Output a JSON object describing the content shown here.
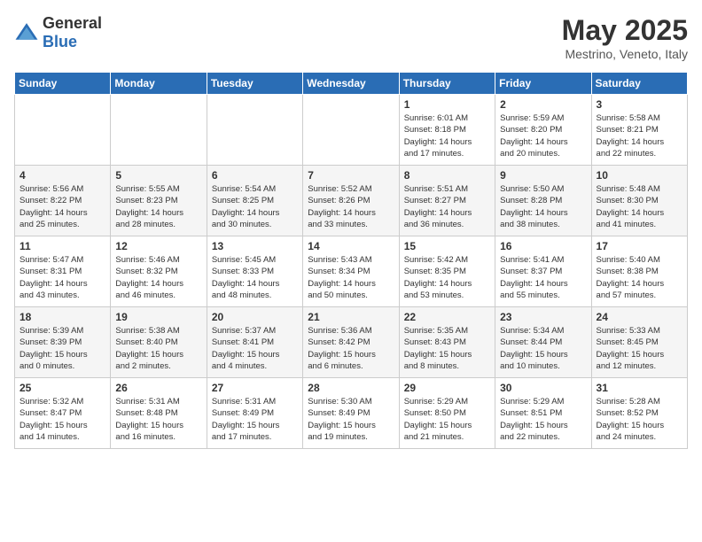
{
  "header": {
    "logo_general": "General",
    "logo_blue": "Blue",
    "title": "May 2025",
    "subtitle": "Mestrino, Veneto, Italy"
  },
  "weekdays": [
    "Sunday",
    "Monday",
    "Tuesday",
    "Wednesday",
    "Thursday",
    "Friday",
    "Saturday"
  ],
  "weeks": [
    [
      {
        "day": "",
        "info": ""
      },
      {
        "day": "",
        "info": ""
      },
      {
        "day": "",
        "info": ""
      },
      {
        "day": "",
        "info": ""
      },
      {
        "day": "1",
        "info": "Sunrise: 6:01 AM\nSunset: 8:18 PM\nDaylight: 14 hours\nand 17 minutes."
      },
      {
        "day": "2",
        "info": "Sunrise: 5:59 AM\nSunset: 8:20 PM\nDaylight: 14 hours\nand 20 minutes."
      },
      {
        "day": "3",
        "info": "Sunrise: 5:58 AM\nSunset: 8:21 PM\nDaylight: 14 hours\nand 22 minutes."
      }
    ],
    [
      {
        "day": "4",
        "info": "Sunrise: 5:56 AM\nSunset: 8:22 PM\nDaylight: 14 hours\nand 25 minutes."
      },
      {
        "day": "5",
        "info": "Sunrise: 5:55 AM\nSunset: 8:23 PM\nDaylight: 14 hours\nand 28 minutes."
      },
      {
        "day": "6",
        "info": "Sunrise: 5:54 AM\nSunset: 8:25 PM\nDaylight: 14 hours\nand 30 minutes."
      },
      {
        "day": "7",
        "info": "Sunrise: 5:52 AM\nSunset: 8:26 PM\nDaylight: 14 hours\nand 33 minutes."
      },
      {
        "day": "8",
        "info": "Sunrise: 5:51 AM\nSunset: 8:27 PM\nDaylight: 14 hours\nand 36 minutes."
      },
      {
        "day": "9",
        "info": "Sunrise: 5:50 AM\nSunset: 8:28 PM\nDaylight: 14 hours\nand 38 minutes."
      },
      {
        "day": "10",
        "info": "Sunrise: 5:48 AM\nSunset: 8:30 PM\nDaylight: 14 hours\nand 41 minutes."
      }
    ],
    [
      {
        "day": "11",
        "info": "Sunrise: 5:47 AM\nSunset: 8:31 PM\nDaylight: 14 hours\nand 43 minutes."
      },
      {
        "day": "12",
        "info": "Sunrise: 5:46 AM\nSunset: 8:32 PM\nDaylight: 14 hours\nand 46 minutes."
      },
      {
        "day": "13",
        "info": "Sunrise: 5:45 AM\nSunset: 8:33 PM\nDaylight: 14 hours\nand 48 minutes."
      },
      {
        "day": "14",
        "info": "Sunrise: 5:43 AM\nSunset: 8:34 PM\nDaylight: 14 hours\nand 50 minutes."
      },
      {
        "day": "15",
        "info": "Sunrise: 5:42 AM\nSunset: 8:35 PM\nDaylight: 14 hours\nand 53 minutes."
      },
      {
        "day": "16",
        "info": "Sunrise: 5:41 AM\nSunset: 8:37 PM\nDaylight: 14 hours\nand 55 minutes."
      },
      {
        "day": "17",
        "info": "Sunrise: 5:40 AM\nSunset: 8:38 PM\nDaylight: 14 hours\nand 57 minutes."
      }
    ],
    [
      {
        "day": "18",
        "info": "Sunrise: 5:39 AM\nSunset: 8:39 PM\nDaylight: 15 hours\nand 0 minutes."
      },
      {
        "day": "19",
        "info": "Sunrise: 5:38 AM\nSunset: 8:40 PM\nDaylight: 15 hours\nand 2 minutes."
      },
      {
        "day": "20",
        "info": "Sunrise: 5:37 AM\nSunset: 8:41 PM\nDaylight: 15 hours\nand 4 minutes."
      },
      {
        "day": "21",
        "info": "Sunrise: 5:36 AM\nSunset: 8:42 PM\nDaylight: 15 hours\nand 6 minutes."
      },
      {
        "day": "22",
        "info": "Sunrise: 5:35 AM\nSunset: 8:43 PM\nDaylight: 15 hours\nand 8 minutes."
      },
      {
        "day": "23",
        "info": "Sunrise: 5:34 AM\nSunset: 8:44 PM\nDaylight: 15 hours\nand 10 minutes."
      },
      {
        "day": "24",
        "info": "Sunrise: 5:33 AM\nSunset: 8:45 PM\nDaylight: 15 hours\nand 12 minutes."
      }
    ],
    [
      {
        "day": "25",
        "info": "Sunrise: 5:32 AM\nSunset: 8:47 PM\nDaylight: 15 hours\nand 14 minutes."
      },
      {
        "day": "26",
        "info": "Sunrise: 5:31 AM\nSunset: 8:48 PM\nDaylight: 15 hours\nand 16 minutes."
      },
      {
        "day": "27",
        "info": "Sunrise: 5:31 AM\nSunset: 8:49 PM\nDaylight: 15 hours\nand 17 minutes."
      },
      {
        "day": "28",
        "info": "Sunrise: 5:30 AM\nSunset: 8:49 PM\nDaylight: 15 hours\nand 19 minutes."
      },
      {
        "day": "29",
        "info": "Sunrise: 5:29 AM\nSunset: 8:50 PM\nDaylight: 15 hours\nand 21 minutes."
      },
      {
        "day": "30",
        "info": "Sunrise: 5:29 AM\nSunset: 8:51 PM\nDaylight: 15 hours\nand 22 minutes."
      },
      {
        "day": "31",
        "info": "Sunrise: 5:28 AM\nSunset: 8:52 PM\nDaylight: 15 hours\nand 24 minutes."
      }
    ]
  ]
}
